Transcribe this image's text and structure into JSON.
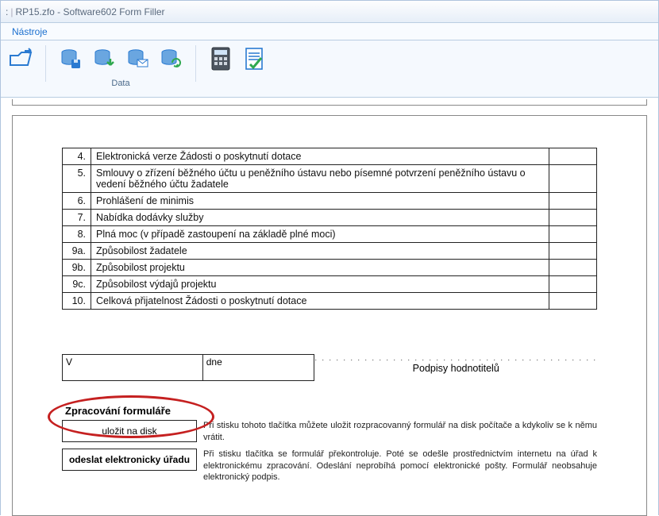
{
  "window": {
    "filename": "RP15.zfo",
    "app": "Software602 Form Filler"
  },
  "menu": {
    "tools": "Nástroje"
  },
  "ribbon": {
    "group_data": "Data"
  },
  "form": {
    "rows": [
      {
        "n": "4.",
        "text": "Elektronická verze Žádosti o poskytnutí dotace"
      },
      {
        "n": "5.",
        "text": "Smlouvy o zřízení běžného účtu u peněžního ústavu nebo písemné potvrzení peněžního ústavu o vedení běžného účtu žadatele"
      },
      {
        "n": "6.",
        "text": "Prohlášení de minimis"
      },
      {
        "n": "7.",
        "text": "Nabídka dodávky služby"
      },
      {
        "n": "8.",
        "text": "Plná moc (v případě zastoupení na základě plné moci)"
      },
      {
        "n": "9a.",
        "text": "Způsobilost žadatele"
      },
      {
        "n": "9b.",
        "text": "Způsobilost projektu"
      },
      {
        "n": "9c.",
        "text": "Způsobilost výdajů projektu"
      },
      {
        "n": "10.",
        "text": "Celková přijatelnost Žádosti o poskytnutí dotace"
      }
    ],
    "sig": {
      "v": "V",
      "dne": "dne",
      "caption": "Podpisy hodnotitelů"
    },
    "proc": {
      "title": "Zpracování formuláře",
      "save_btn": "uložit na disk",
      "save_text": "Při stisku tohoto tlačítka můžete uložit rozpracovanný formulář na disk počítače a kdykoliv se k němu vrátit.",
      "send_btn": "odeslat elektronicky úřadu",
      "send_text": "Při stisku tlačítka se formulář překontroluje. Poté se odešle prostřednictvím internetu na úřad k elektronickému zpracování. Odeslání neprobíhá pomocí elektronické pošty. Formulář neobsahuje elektronický podpis."
    }
  }
}
